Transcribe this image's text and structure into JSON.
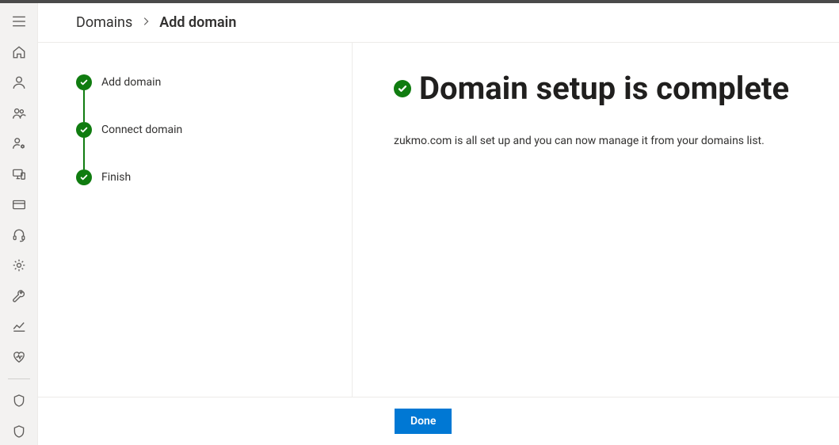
{
  "breadcrumb": {
    "parent": "Domains",
    "current": "Add domain"
  },
  "steps": [
    {
      "label": "Add domain"
    },
    {
      "label": "Connect domain"
    },
    {
      "label": "Finish"
    }
  ],
  "detail": {
    "title": "Domain setup is complete",
    "description": "zukmo.com is all set up and you can now manage it from your domains list."
  },
  "footer": {
    "done_label": "Done"
  },
  "rail": {
    "items": [
      "menu",
      "home",
      "user",
      "users",
      "user-gear",
      "devices",
      "billing",
      "support",
      "settings",
      "wrench",
      "reports",
      "health",
      "sep",
      "security",
      "compliance"
    ]
  },
  "colors": {
    "accent_green": "#107c10",
    "accent_blue": "#0078d4"
  }
}
